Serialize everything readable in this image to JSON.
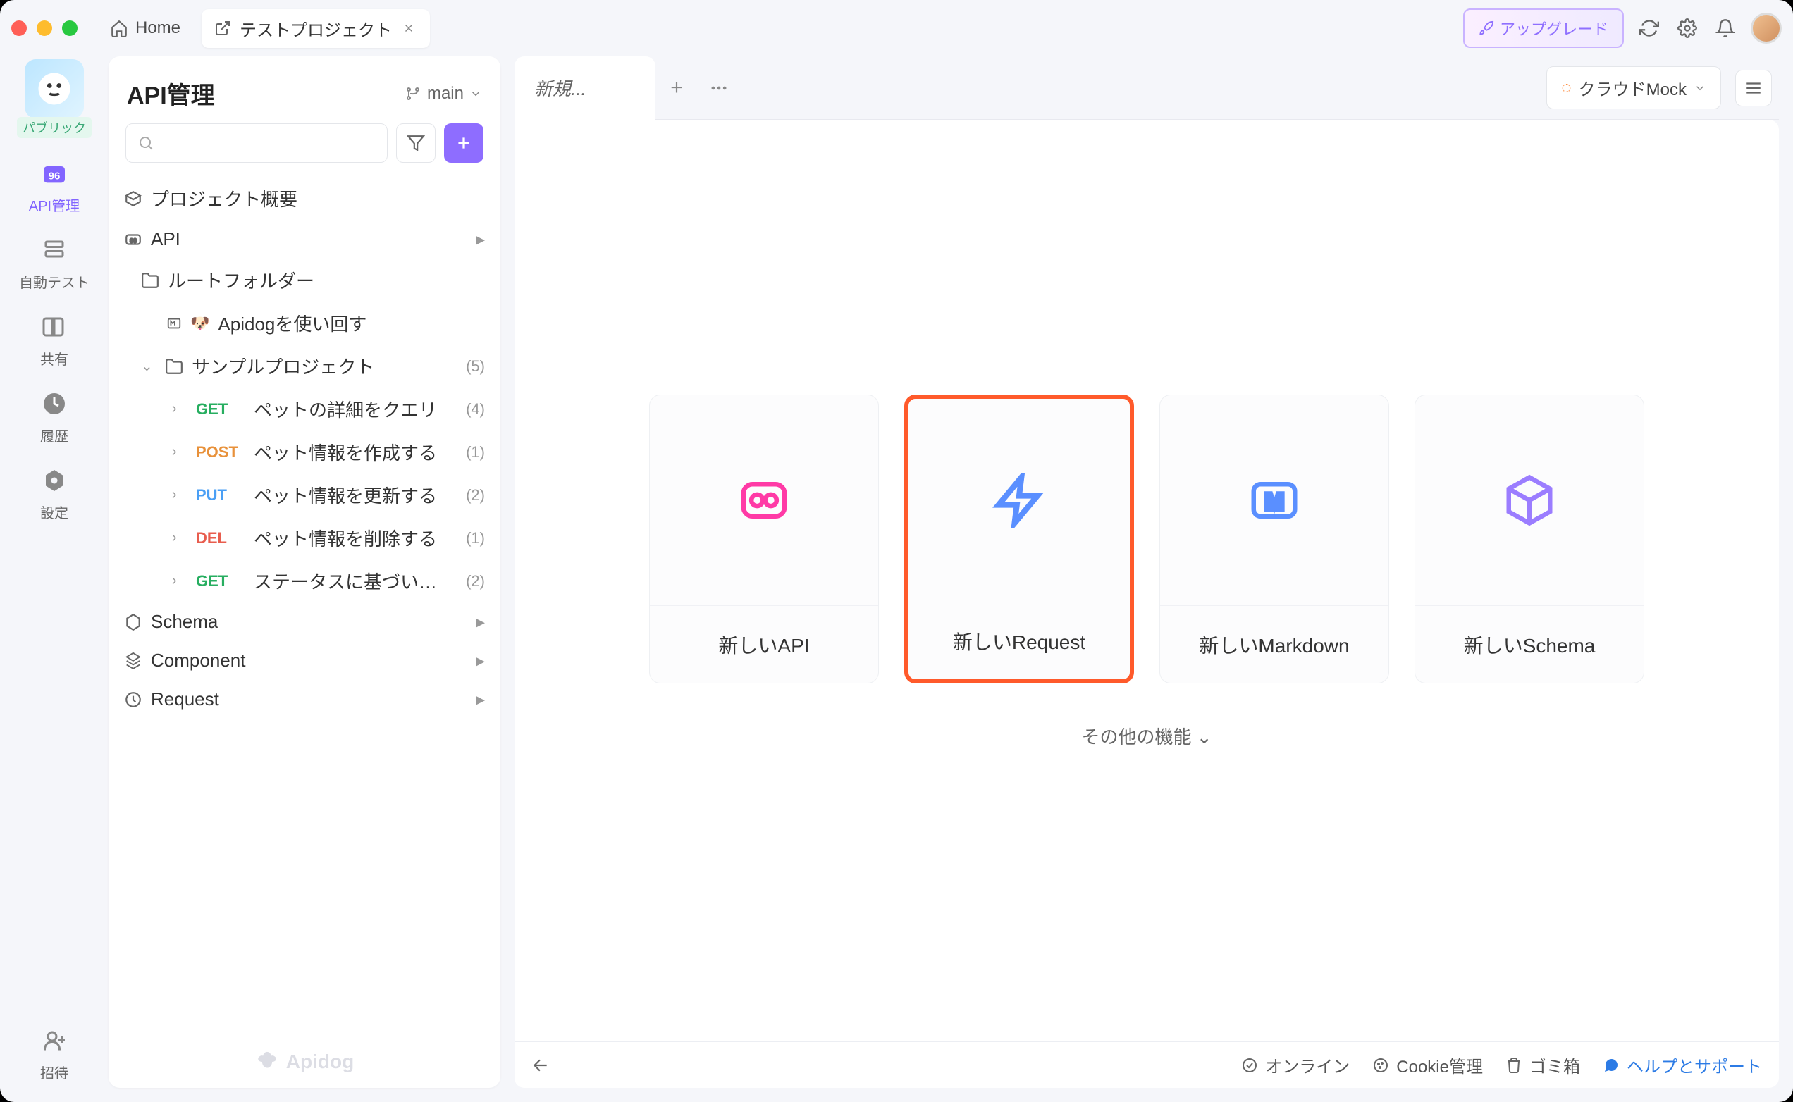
{
  "titlebar": {
    "home": "Home",
    "tab_name": "テストプロジェクト",
    "upgrade": "アップグレード"
  },
  "rail": {
    "public_badge": "パブリック",
    "items": [
      {
        "label": "API管理"
      },
      {
        "label": "自動テスト"
      },
      {
        "label": "共有"
      },
      {
        "label": "履歴"
      },
      {
        "label": "設定"
      },
      {
        "label": "招待"
      }
    ]
  },
  "sidebar": {
    "title": "API管理",
    "branch": "main",
    "project_overview": "プロジェクト概要",
    "api_label": "API",
    "root_folder": "ルートフォルダー",
    "apidog_sample": "Apidogを使い回す",
    "sample_project": "サンプルプロジェクト",
    "sample_project_count": "(5)",
    "endpoints": [
      {
        "method": "GET",
        "label": "ペットの詳細をクエリ",
        "count": "(4)",
        "cls": "m-get"
      },
      {
        "method": "POST",
        "label": "ペット情報を作成する",
        "count": "(1)",
        "cls": "m-post"
      },
      {
        "method": "PUT",
        "label": "ペット情報を更新する",
        "count": "(2)",
        "cls": "m-put"
      },
      {
        "method": "DEL",
        "label": "ペット情報を削除する",
        "count": "(1)",
        "cls": "m-del"
      },
      {
        "method": "GET",
        "label": "ステータスに基づい…",
        "count": "(2)",
        "cls": "m-get"
      }
    ],
    "schema": "Schema",
    "component": "Component",
    "request": "Request",
    "footer_brand": "Apidog"
  },
  "main": {
    "tab_new": "新規...",
    "env_label": "クラウドMock",
    "cards": [
      {
        "label": "新しいAPI"
      },
      {
        "label": "新しいRequest"
      },
      {
        "label": "新しいMarkdown"
      },
      {
        "label": "新しいSchema"
      }
    ],
    "more": "その他の機能"
  },
  "status": {
    "online": "オンライン",
    "cookie": "Cookie管理",
    "trash": "ゴミ箱",
    "help": "ヘルプとサポート"
  }
}
